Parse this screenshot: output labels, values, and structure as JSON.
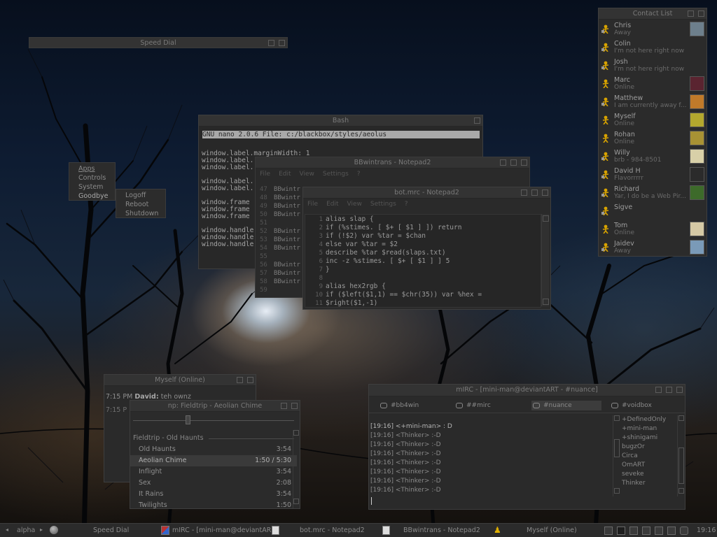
{
  "speed_dial": {
    "title": "Speed Dial"
  },
  "contact_list": {
    "title": "Contact List",
    "contacts": [
      {
        "name": "Chris",
        "status": "Away",
        "avatar_color": "#6d7f8c"
      },
      {
        "name": "Colin",
        "status": "I'm not here right now",
        "avatar_color": ""
      },
      {
        "name": "Josh",
        "status": "I'm not here right now",
        "avatar_color": ""
      },
      {
        "name": "Marc",
        "status": "Online",
        "avatar_color": "#5a2430"
      },
      {
        "name": "Matthew",
        "status": "I am currently away f...",
        "avatar_color": "#c07a2a"
      },
      {
        "name": "Myself",
        "status": "Online",
        "avatar_color": "#b3a82e"
      },
      {
        "name": "Rohan",
        "status": "Online",
        "avatar_color": "#a89234"
      },
      {
        "name": "Willy",
        "status": "brb - 984-8501",
        "avatar_color": "#d8d0a8"
      },
      {
        "name": "David H",
        "status": "Flavorrrrr",
        "avatar_color": "#2b2b2b"
      },
      {
        "name": "Richard",
        "status": "Yar, I do be a Web Pir...",
        "avatar_color": "#3d6a2a"
      },
      {
        "name": "Sigve",
        "status": "",
        "avatar_color": ""
      },
      {
        "name": "Tom",
        "status": "Online",
        "avatar_color": "#d5c9a5"
      },
      {
        "name": "Jaidev",
        "status": "Away",
        "avatar_color": "#7a9ab8"
      }
    ]
  },
  "bash": {
    "title": "Bash",
    "nano_header": " GNU nano 2.0.6    File: c:/blackbox/styles/aeolus",
    "lines": [
      "window.label.marginWidth:          1",
      "window.label.",
      "window.label.",
      "",
      "window.label.",
      "window.label.",
      "",
      "window.frame",
      "window.frame",
      "window.frame",
      "",
      "window.handle",
      "window.handle",
      "window.handle"
    ]
  },
  "bbwintrans": {
    "title": "BBwintrans - Notepad2",
    "menu": [
      "File",
      "Edit",
      "View",
      "Settings",
      "?"
    ],
    "line_numbers": [
      "47",
      "48",
      "49",
      "50",
      "51",
      "52",
      "53",
      "54",
      "55",
      "56",
      "57",
      "58",
      "59"
    ],
    "lines": [
      "BBwintr",
      "BBwintr",
      "BBwintr",
      "BBwintr",
      "",
      "BBwintr",
      "BBwintr",
      "BBwintr",
      "",
      "BBwintr",
      "BBwintr",
      "BBwintr",
      ""
    ]
  },
  "botmrc": {
    "title": "bot.mrc - Notepad2",
    "menu": [
      "File",
      "Edit",
      "View",
      "Settings",
      "?"
    ],
    "line_numbers": [
      "1",
      "2",
      "3",
      "4",
      "5",
      "6",
      "7",
      "8",
      "9",
      "10",
      "11"
    ],
    "lines": [
      "alias slap {",
      "    if (%stimes. [ $+ [ $1 ] ]) return",
      "    if (!$2) var %tar = $chan",
      "    else var %tar = $2",
      "    describe %tar $read(slaps.txt)",
      "    inc -z %stimes. [ $+ [ $1 ] ] 5",
      "}",
      "",
      "alias hex2rgb {",
      "    if ($left($1,1) == $chr(35)) var %hex =",
      "$right($1,-1)"
    ]
  },
  "start_menu": {
    "items": [
      "Apps",
      "Controls",
      "System",
      "Goodbye"
    ],
    "submenu": [
      "Logoff",
      "Reboot",
      "Shutdown"
    ]
  },
  "chat_window": {
    "title": "Myself (Online)",
    "line1_time": "7:15 PM",
    "line1_user": "David:",
    "line1_text": "teh ownz",
    "line2_time": "7:15 P"
  },
  "player": {
    "title": "np: Fieldtrip - Aeolian Chime",
    "seek_fraction": 0.34,
    "album": "Fieldtrip - Old Haunts",
    "tracks": [
      {
        "title": "Old Haunts",
        "time": "3:54"
      },
      {
        "title": "Aeolian Chime",
        "time": "1:50 / 5:30"
      },
      {
        "title": "Inflight",
        "time": "3:54"
      },
      {
        "title": "Sex",
        "time": "2:08"
      },
      {
        "title": "It Rains",
        "time": "3:54"
      },
      {
        "title": "Twilights",
        "time": "1:50"
      }
    ],
    "selected_index": 1
  },
  "mirc": {
    "title": "mIRC - [mini-man@deviantART - #nuance]",
    "channels": [
      "#bb4win",
      "##mirc",
      "#nuance",
      "#voidbox"
    ],
    "active_channel": 2,
    "messages": [
      "[19:16] <+mini-man> : D",
      "[19:16] <Thinker> :-D",
      "[19:16] <Thinker> :-D",
      "[19:16] <Thinker> :-D",
      "[19:16] <Thinker> :-D",
      "[19:16] <Thinker> :-D",
      "[19:16] <Thinker> :-D",
      "[19:16] <Thinker> :-D"
    ],
    "users": [
      "+DefinedOnly",
      "+mini-man",
      "+shinigami",
      "bugzOr",
      "Circa",
      "OmART",
      "seveke",
      "Thinker"
    ]
  },
  "taskbar": {
    "workspace": "alpha",
    "tasks": [
      "Speed Dial",
      "mIRC - [mini-man@deviantAR...",
      "bot.mrc - Notepad2",
      "BBwintrans - Notepad2",
      "Myself (Online)"
    ],
    "clock": "19:16"
  }
}
